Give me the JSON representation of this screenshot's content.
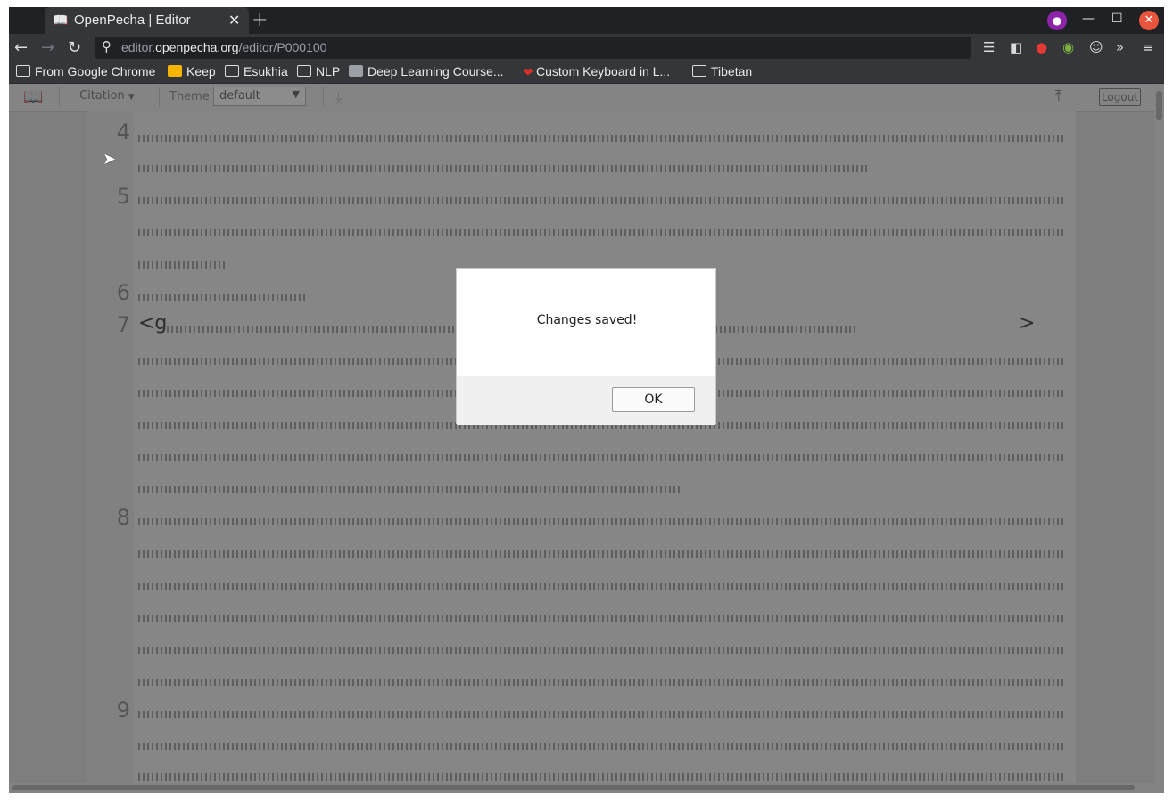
{
  "browser": {
    "tab_title": "OpenPecha | Editor",
    "tab_icon": "book-icon",
    "new_tab_label": "+",
    "url_host": "editor.openpecha.org",
    "url_path": "/editor/P000100",
    "url_host_prefix": "editor.",
    "url_host_main": "openpecha.org",
    "bookmarks": [
      {
        "label": "From Google Chrome",
        "icon": "folder-icon"
      },
      {
        "label": "Keep",
        "icon": "keep-icon"
      },
      {
        "label": "Esukhia",
        "icon": "folder-icon"
      },
      {
        "label": "NLP",
        "icon": "folder-icon"
      },
      {
        "label": "Deep Learning Course...",
        "icon": "page-icon"
      },
      {
        "label": "Custom Keyboard in L...",
        "icon": "page-icon"
      },
      {
        "label": "Tibetan",
        "icon": "folder-icon"
      }
    ]
  },
  "app": {
    "citation_label": "Citation",
    "theme_label": "Theme",
    "theme_value": "default",
    "logout_label": "Logout",
    "line_numbers": [
      "4",
      "5",
      "6",
      "7",
      "8",
      "9"
    ],
    "tag_open": "<g",
    "tag_close": ">"
  },
  "dialog": {
    "message": "Changes saved!",
    "ok_label": "OK"
  },
  "colors": {
    "titlebar": "#202124",
    "toolbar": "#35363a",
    "incognito": "#8e24aa",
    "close": "#e8553c"
  }
}
